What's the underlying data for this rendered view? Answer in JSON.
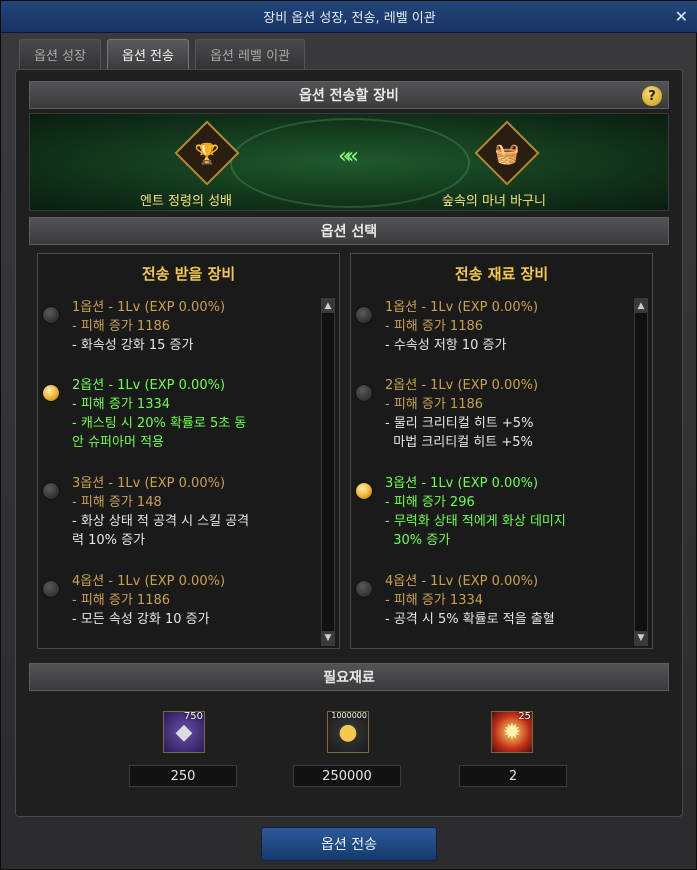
{
  "window": {
    "title": "장비 옵션 성장, 전송, 레벨 이관",
    "close": "✕"
  },
  "tabs": [
    {
      "label": "옵션 성장"
    },
    {
      "label": "옵션 전송"
    },
    {
      "label": "옵션 레벨 이관"
    }
  ],
  "target_section": {
    "title": "옵션 전송할 장비",
    "help": "?",
    "left_item_name": "엔트 정령의 성배",
    "right_item_name": "숲속의 마녀 바구니",
    "arrow": "«"
  },
  "option_section": {
    "title": "옵션 선택"
  },
  "left_column": {
    "title": "전송 받을 장비",
    "options": [
      {
        "head": "1옵션 - 1Lv (EXP 0.00%)",
        "sub": "- 피해 증가 1186",
        "eff": [
          "- 화속성 강화 15 증가"
        ],
        "selected": false
      },
      {
        "head": "2옵션 - 1Lv (EXP 0.00%)",
        "sub": "- 피해 증가 1334",
        "eff": [
          "- 캐스팅 시 20% 확률로 5초 동",
          "안 슈퍼아머 적용"
        ],
        "selected": true
      },
      {
        "head": "3옵션 - 1Lv (EXP 0.00%)",
        "sub": "- 피해 증가 148",
        "eff": [
          "- 화상 상태 적 공격 시 스킬 공격",
          "력 10% 증가"
        ],
        "selected": false
      },
      {
        "head": "4옵션 - 1Lv (EXP 0.00%)",
        "sub": "- 피해 증가 1186",
        "eff": [
          "- 모든 속성 강화 10 증가"
        ],
        "selected": false
      }
    ]
  },
  "right_column": {
    "title": "전송 재료 장비",
    "options": [
      {
        "head": "1옵션 - 1Lv (EXP 0.00%)",
        "sub": "- 피해 증가 1186",
        "eff": [
          "- 수속성 저항 10 증가"
        ],
        "selected": false
      },
      {
        "head": "2옵션 - 1Lv (EXP 0.00%)",
        "sub": "- 피해 증가 1186",
        "eff": [
          "- 물리 크리티컬 히트 +5%",
          "  마법 크리티컬 히트 +5%"
        ],
        "selected": false
      },
      {
        "head": "3옵션 - 1Lv (EXP 0.00%)",
        "sub": "- 피해 증가 296",
        "eff": [
          "- 무력화 상태 적에게 화상 데미지",
          "  30% 증가"
        ],
        "selected": true
      },
      {
        "head": "4옵션 - 1Lv (EXP 0.00%)",
        "sub": "- 피해 증가 1334",
        "eff": [
          "- 공격 시 5% 확률로 적을 출혈"
        ],
        "selected": false
      }
    ]
  },
  "materials_section": {
    "title": "필요재료",
    "items": [
      {
        "badge": "750",
        "icon": "gold-crystal-icon",
        "qty": "250"
      },
      {
        "badge": "1000000",
        "icon": "gold-coins-icon",
        "qty": "250000"
      },
      {
        "badge": "25",
        "icon": "fire-burst-icon",
        "qty": "2"
      }
    ]
  },
  "submit_button": {
    "label": "옵션 전송"
  },
  "scroll": {
    "up": "▲",
    "down": "▼"
  }
}
